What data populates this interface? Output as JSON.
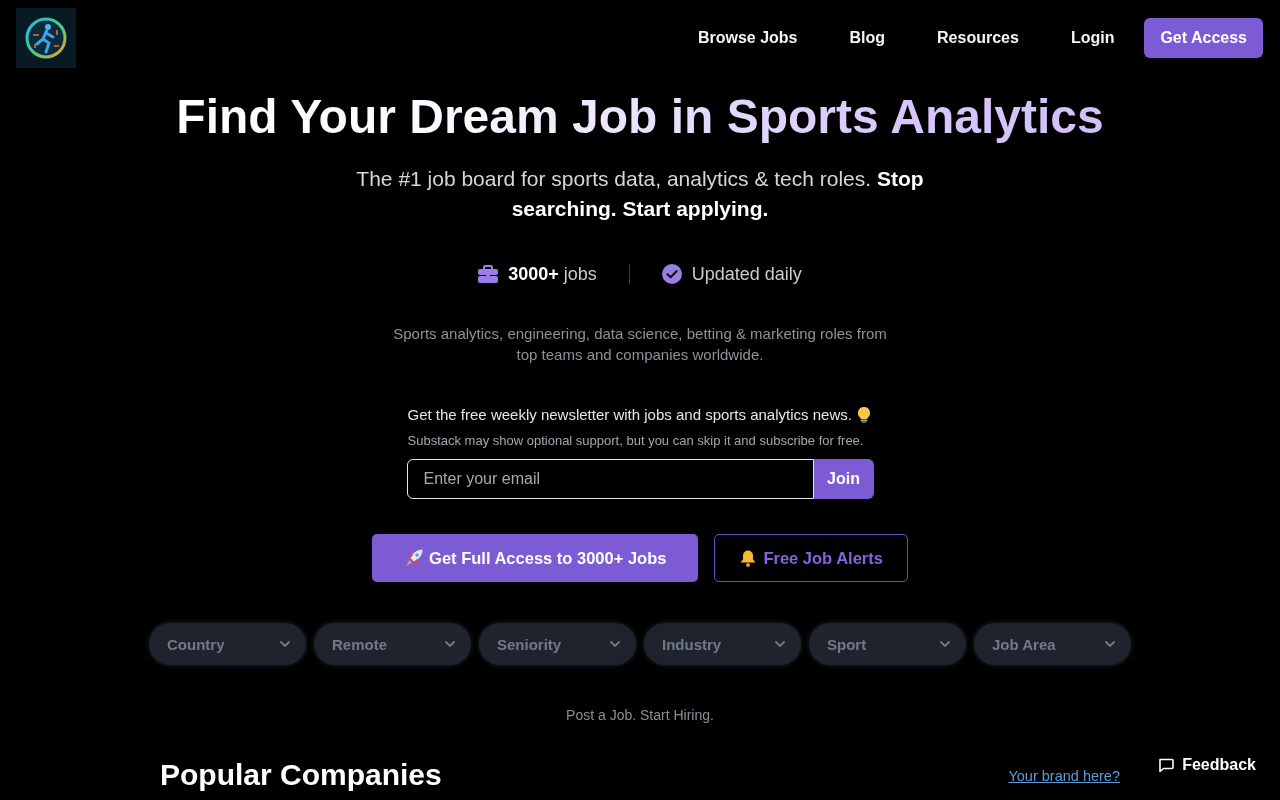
{
  "header": {
    "nav_links": [
      "Browse Jobs",
      "Blog",
      "Resources",
      "Login"
    ],
    "cta": "Get Access"
  },
  "hero": {
    "title": "Find Your Dream Job in Sports Analytics",
    "subtitle": "The #1 job board for sports data, analytics & tech roles. **Stop searching. Start applying.**",
    "stats": [
      {
        "kind": "jobs",
        "text": "**3000+** jobs"
      },
      {
        "kind": "updated",
        "text": "Updated daily"
      }
    ],
    "description": "Sports analytics, engineering, data science, betting & marketing roles from top teams and companies worldwide."
  },
  "newsletter": {
    "heading": "Get the free weekly newsletter with jobs and sports analytics news.",
    "note": "Substack may show optional support, but you can skip it and subscribe for free.",
    "email": {
      "placeholder": "Enter your email"
    },
    "button": "Join"
  },
  "actions": [
    {
      "kind": "primary",
      "label": "Get Full Access to 3000+ Jobs"
    },
    {
      "kind": "outline",
      "label": "Free Job Alerts"
    }
  ],
  "filters": [
    "Country",
    "Remote",
    "Seniority",
    "Industry",
    "Sport",
    "Job Area"
  ],
  "post_job": "Post a Job. Start Hiring.",
  "popular_companies": {
    "title": "Popular Companies",
    "link": "Your brand here?"
  },
  "feedback": "Feedback"
}
